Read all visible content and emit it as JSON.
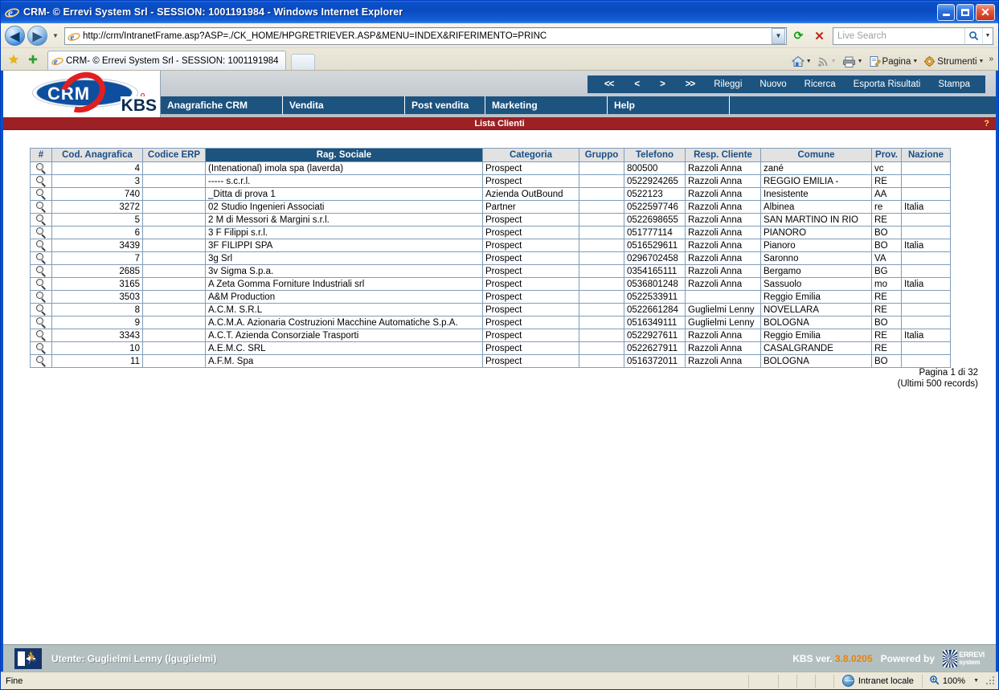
{
  "window": {
    "title": "CRM- © Errevi System Srl - SESSION: 1001191984 - Windows Internet Explorer",
    "minimize_label": "_",
    "maximize_label": "□",
    "close_label": "✕"
  },
  "browser": {
    "back_glyph": "◀",
    "forward_glyph": "▶",
    "history_caret": "▼",
    "url": "http://crm/IntranetFrame.asp?ASP=./CK_HOME/HPGRETRIEVER.ASP&MENU=INDEX&RIFERIMENTO=PRINC",
    "url_dropdown_caret": "▼",
    "refresh_glyph": "⟳",
    "stop_glyph": "✕",
    "search_placeholder": "Live Search",
    "search_value": "",
    "search_go_glyph": "🔍",
    "search_caret": "▼",
    "tab_label": "CRM- © Errevi System Srl - SESSION: 1001191984",
    "new_tab_label": "",
    "toolbar": {
      "home_label": "",
      "feeds_label": "",
      "print_label": "",
      "page_label": "Pagina",
      "tools_label": "Strumenti",
      "overflow_label": "»"
    }
  },
  "crm": {
    "logo_text": "CRM",
    "logo_suite": "KBS",
    "nav_toolbar": [
      {
        "label": "<<",
        "name": "first"
      },
      {
        "label": "<",
        "name": "prev"
      },
      {
        "label": ">",
        "name": "next"
      },
      {
        "label": ">>",
        "name": "last"
      },
      {
        "label": "Rileggi",
        "name": "reload"
      },
      {
        "label": "Nuovo",
        "name": "new"
      },
      {
        "label": "Ricerca",
        "name": "search"
      },
      {
        "label": "Esporta Risultati",
        "name": "export"
      },
      {
        "label": "Stampa",
        "name": "print"
      }
    ],
    "menu": [
      "Anagrafiche CRM",
      "Vendita",
      "Post vendita",
      "Marketing",
      "Help"
    ],
    "page_title": "Lista Clienti",
    "help_glyph": "?"
  },
  "grid": {
    "columns": [
      {
        "key": "mag",
        "label": "#"
      },
      {
        "key": "cod",
        "label": "Cod. Anagrafica"
      },
      {
        "key": "erp",
        "label": "Codice ERP"
      },
      {
        "key": "rag",
        "label": "Rag. Sociale"
      },
      {
        "key": "cat",
        "label": "Categoria"
      },
      {
        "key": "grp",
        "label": "Gruppo"
      },
      {
        "key": "tel",
        "label": "Telefono"
      },
      {
        "key": "resp",
        "label": "Resp. Cliente"
      },
      {
        "key": "com",
        "label": "Comune"
      },
      {
        "key": "prov",
        "label": "Prov."
      },
      {
        "key": "naz",
        "label": "Nazione"
      }
    ],
    "rows": [
      {
        "cod": "4",
        "erp": "",
        "rag": "(Intenational) imola spa (laverda)",
        "cat": "Prospect",
        "grp": "",
        "tel": "800500",
        "resp": "Razzoli Anna",
        "com": "zané",
        "prov": "vc",
        "naz": ""
      },
      {
        "cod": "3",
        "erp": "",
        "rag": "----- s.c.r.l.",
        "cat": "Prospect",
        "grp": "",
        "tel": "0522924265",
        "resp": "Razzoli Anna",
        "com": "REGGIO EMILIA -",
        "prov": "RE",
        "naz": ""
      },
      {
        "cod": "740",
        "erp": "",
        "rag": "_Ditta di prova 1",
        "cat": "Azienda OutBound",
        "grp": "",
        "tel": "0522123",
        "resp": "Razzoli Anna",
        "com": "Inesistente",
        "prov": "AA",
        "naz": ""
      },
      {
        "cod": "3272",
        "erp": "",
        "rag": "02 Studio Ingenieri Associati",
        "cat": "Partner",
        "grp": "",
        "tel": "0522597746",
        "resp": "Razzoli Anna",
        "com": "Albinea",
        "prov": "re",
        "naz": "Italia"
      },
      {
        "cod": "5",
        "erp": "",
        "rag": "2 M di Messori & Margini s.r.l.",
        "cat": "Prospect",
        "grp": "",
        "tel": "0522698655",
        "resp": "Razzoli Anna",
        "com": "SAN MARTINO IN RIO",
        "prov": "RE",
        "naz": ""
      },
      {
        "cod": "6",
        "erp": "",
        "rag": "3 F Filippi s.r.l.",
        "cat": "Prospect",
        "grp": "",
        "tel": "051777114",
        "resp": "Razzoli Anna",
        "com": "PIANORO",
        "prov": "BO",
        "naz": ""
      },
      {
        "cod": "3439",
        "erp": "",
        "rag": "3F FILIPPI SPA",
        "cat": "Prospect",
        "grp": "",
        "tel": "0516529611",
        "resp": "Razzoli Anna",
        "com": "Pianoro",
        "prov": "BO",
        "naz": "Italia"
      },
      {
        "cod": "7",
        "erp": "",
        "rag": "3g Srl",
        "cat": "Prospect",
        "grp": "",
        "tel": "0296702458",
        "resp": "Razzoli Anna",
        "com": "Saronno",
        "prov": "VA",
        "naz": ""
      },
      {
        "cod": "2685",
        "erp": "",
        "rag": "3v Sigma S.p.a.",
        "cat": "Prospect",
        "grp": "",
        "tel": "0354165111",
        "resp": "Razzoli Anna",
        "com": "Bergamo",
        "prov": "BG",
        "naz": ""
      },
      {
        "cod": "3165",
        "erp": "",
        "rag": "A Zeta Gomma Forniture Industriali srl",
        "cat": "Prospect",
        "grp": "",
        "tel": "0536801248",
        "resp": "Razzoli Anna",
        "com": "Sassuolo",
        "prov": "mo",
        "naz": "Italia"
      },
      {
        "cod": "3503",
        "erp": "",
        "rag": "A&M Production",
        "cat": "Prospect",
        "grp": "",
        "tel": "0522533911",
        "resp": "",
        "com": "Reggio Emilia",
        "prov": "RE",
        "naz": ""
      },
      {
        "cod": "8",
        "erp": "",
        "rag": "A.C.M. S.R.L",
        "cat": "Prospect",
        "grp": "",
        "tel": "0522661284",
        "resp": "Guglielmi Lenny",
        "com": "NOVELLARA",
        "prov": "RE",
        "naz": ""
      },
      {
        "cod": "9",
        "erp": "",
        "rag": "A.C.M.A. Azionaria Costruzioni Macchine Automatiche S.p.A.",
        "cat": "Prospect",
        "grp": "",
        "tel": "0516349111",
        "resp": "Guglielmi Lenny",
        "com": "BOLOGNA",
        "prov": "BO",
        "naz": ""
      },
      {
        "cod": "3343",
        "erp": "",
        "rag": "A.C.T. Azienda Consorziale Trasporti",
        "cat": "Prospect",
        "grp": "",
        "tel": "0522927611",
        "resp": "Razzoli Anna",
        "com": "Reggio Emilia",
        "prov": "RE",
        "naz": "Italia"
      },
      {
        "cod": "10",
        "erp": "",
        "rag": "A.E.M.C. SRL",
        "cat": "Prospect",
        "grp": "",
        "tel": "0522627911",
        "resp": "Razzoli Anna",
        "com": "CASALGRANDE",
        "prov": "RE",
        "naz": ""
      },
      {
        "cod": "11",
        "erp": "",
        "rag": "A.F.M. Spa",
        "cat": "Prospect",
        "grp": "",
        "tel": "0516372011",
        "resp": "Razzoli Anna",
        "com": "BOLOGNA",
        "prov": "BO",
        "naz": ""
      }
    ],
    "pager_line1": "Pagina 1 di 32",
    "pager_line2": "(Ultimi 500 records)"
  },
  "crm_footer": {
    "user_label": "Utente: Guglielmi Lenny (lguglielmi)",
    "version_label": "KBS ver.",
    "version_number": "3.8.0205",
    "powered_by": "Powered by",
    "vendor_line1": "ERREVI",
    "vendor_line2": "system"
  },
  "statusbar": {
    "status_text": "Fine",
    "zone_text": "Intranet locale",
    "zoom_text": "100%",
    "zoom_caret": "▼"
  },
  "colors": {
    "title_blue": "#0b4fc4",
    "crm_blue": "#1c537f",
    "crm_red": "#9c2024",
    "link_blue": "#2020c0",
    "accent_orange": "#e8820c",
    "header_gray": "#e2e2e2",
    "grid_border": "#7f9db9"
  }
}
